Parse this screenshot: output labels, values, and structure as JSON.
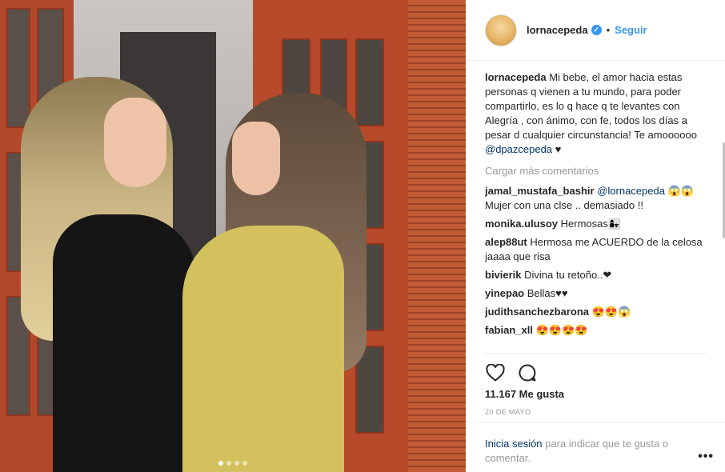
{
  "post": {
    "username": "lornacepeda",
    "follow_label": "Seguir",
    "separator": "•",
    "verified_glyph": "✓",
    "caption": {
      "username": "lornacepeda",
      "text": "Mi bebe, el amor hacia estas personas q vienen a tu mundo, para poder compartirlo, es lo q hace q te levantes con Alegría , con ánimo, con fe, todos los días a pesar d cualquier circunstancia! Te amoooooo ",
      "mention": "@dpazcepeda",
      "suffix": " ♥"
    },
    "load_more_label": "Cargar más comentarios",
    "comments": [
      {
        "username": "jamal_mustafa_bashir",
        "mention": "@lornacepeda",
        "text": " 😱😱 Mujer con una clse .. demasiado !!"
      },
      {
        "username": "monika.ulusoy",
        "mention": "",
        "text": " Hermosas👩‍👧"
      },
      {
        "username": "alep88ut",
        "mention": "",
        "text": " Hermosa me ACUERDO de la celosa jaaaa que risa"
      },
      {
        "username": "bivierik",
        "mention": "",
        "text": " Divina tu retoño..❤"
      },
      {
        "username": "yinepao",
        "mention": "",
        "text": " Bellas♥♥"
      },
      {
        "username": "judithsanchezbarona",
        "mention": "",
        "text": " 😍😍😱"
      },
      {
        "username": "fabian_xll",
        "mention": "",
        "text": " 😍😍😍😍"
      }
    ],
    "likes_label": "11.167 Me gusta",
    "date_label": "20 DE MAYO",
    "login": {
      "link_label": "Inicia sesión",
      "text": " para indicar que te gusta o comentar."
    },
    "more_label": "•••",
    "carousel_dots": 4,
    "carousel_active": 0
  },
  "colors": {
    "accent": "#3897f0",
    "link": "#003569",
    "muted": "#999999",
    "text": "#262626"
  }
}
